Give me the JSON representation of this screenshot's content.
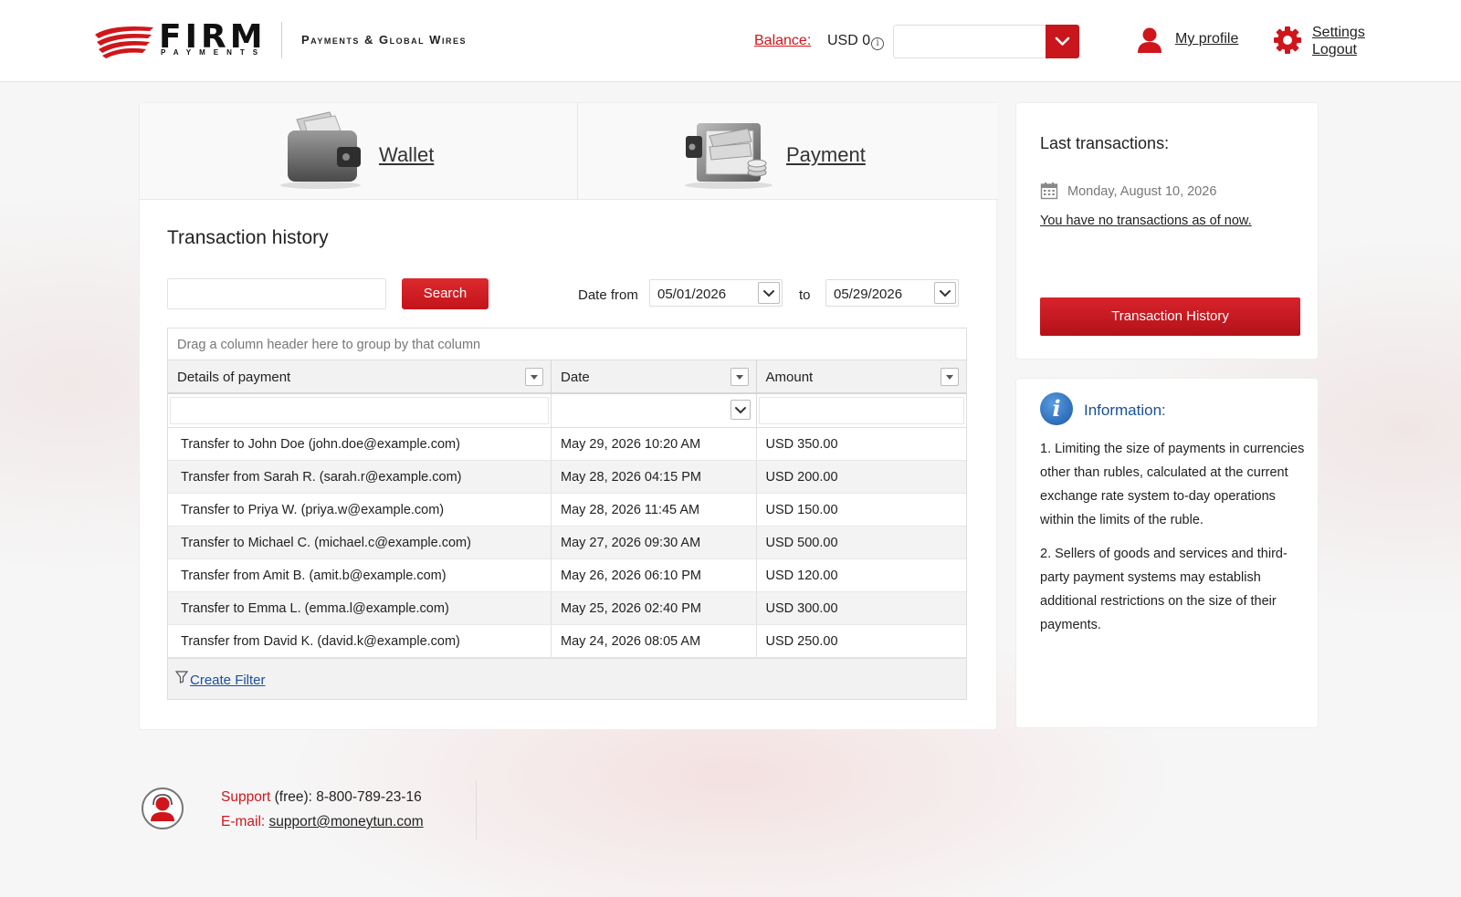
{
  "header": {
    "logo_word": "FIRM",
    "logo_sub": "PAYMENTS",
    "tagline": "Payments & Global Wires",
    "balance_label": "Balance:",
    "balance_value": "USD 0",
    "balance_info_icon": "info-circle-icon",
    "currency_select_value": "",
    "profile_link": "My profile",
    "settings_link": "Settings",
    "logout_link": "Logout",
    "accent_color": "#d0161b"
  },
  "tabs": {
    "wallet_label": "Wallet",
    "payment_label": "Payment"
  },
  "transaction_history": {
    "title": "Transaction history",
    "search_value": "",
    "search_button": "Search",
    "date_from_label": "Date from",
    "date_from_value": "05/01/2026",
    "to_label": "to",
    "date_to_value": "05/29/2026",
    "group_panel_text": "Drag a column header here to group by that column",
    "columns": [
      "Details of payment",
      "Date",
      "Amount"
    ],
    "rows": [
      {
        "details": "Transfer to John Doe (john.doe@example.com)",
        "date": "May 29, 2026 10:20 AM",
        "amount": "USD 350.00"
      },
      {
        "details": "Transfer from Sarah R. (sarah.r@example.com)",
        "date": "May 28, 2026 04:15 PM",
        "amount": "USD 200.00"
      },
      {
        "details": "Transfer to Priya W. (priya.w@example.com)",
        "date": "May 28, 2026 11:45 AM",
        "amount": "USD 150.00"
      },
      {
        "details": "Transfer to Michael C. (michael.c@example.com)",
        "date": "May 27, 2026 09:30 AM",
        "amount": "USD 500.00"
      },
      {
        "details": "Transfer from Amit B. (amit.b@example.com)",
        "date": "May 26, 2026 06:10 PM",
        "amount": "USD 120.00"
      },
      {
        "details": "Transfer to Emma L. (emma.l@example.com)",
        "date": "May 25, 2026 02:40 PM",
        "amount": "USD 300.00"
      },
      {
        "details": "Transfer from David K. (david.k@example.com)",
        "date": "May 24, 2026 08:05 AM",
        "amount": "USD 250.00"
      }
    ],
    "create_filter": "Create Filter"
  },
  "last_transactions": {
    "title": "Last transactions:",
    "date": "Monday, August 10, 2026",
    "message": "You have no transactions as of now.",
    "button": "Transaction History"
  },
  "information": {
    "title": "Information:",
    "para1": "1. Limiting the size of payments in currencies other than rubles, calculated at the current exchange rate system to-day operations within the limits of the ruble.",
    "para2": "2. Sellers of goods and services and third-party payment systems may establish additional restrictions on the size of their payments."
  },
  "footer": {
    "support_label": "Support",
    "support_text": " (free): 8-800-789-23-16",
    "email_label": "E-mail: ",
    "email": "support@moneytun.com"
  }
}
